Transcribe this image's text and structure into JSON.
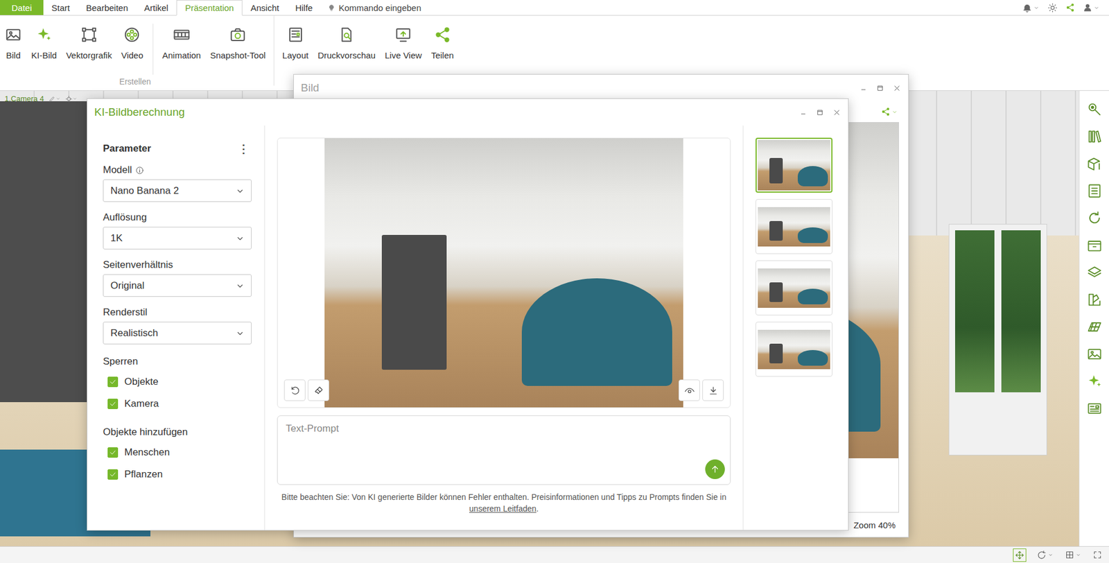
{
  "menubar": {
    "tabs": [
      {
        "label": "Datei",
        "kind": "file",
        "selected": false
      },
      {
        "label": "Start",
        "kind": "tab",
        "selected": false
      },
      {
        "label": "Bearbeiten",
        "kind": "tab",
        "selected": false
      },
      {
        "label": "Artikel",
        "kind": "tab",
        "selected": false
      },
      {
        "label": "Präsentation",
        "kind": "tab",
        "selected": true
      },
      {
        "label": "Ansicht",
        "kind": "tab",
        "selected": false
      },
      {
        "label": "Hilfe",
        "kind": "tab",
        "selected": false
      }
    ],
    "command": {
      "placeholder": "Kommando eingeben"
    }
  },
  "ribbon": {
    "groups": [
      {
        "label": "Erstellen",
        "sections": [
          [
            "Bild",
            "KI-Bild",
            "Vektorgrafik",
            "Video"
          ],
          [
            "Animation",
            "Snapshot-Tool"
          ]
        ]
      },
      {
        "sections": [
          [
            "Layout",
            "Druckvorschau",
            "Live View",
            "Teilen"
          ]
        ]
      }
    ]
  },
  "viewport": {
    "camera": "1.Camera 4"
  },
  "image_window": {
    "title": "Bild",
    "zoom": "Zoom 40%"
  },
  "ai_window": {
    "title": "KI-Bildberechnung",
    "parameters": {
      "heading": "Parameter",
      "menu": "⋮",
      "fields": [
        {
          "label": "Modell",
          "value": "Nano Banana 2",
          "kind": "info"
        },
        {
          "label": "Auflösung",
          "value": "1K",
          "kind": "plain"
        },
        {
          "label": "Seitenverhältnis",
          "value": "Original",
          "kind": "plain"
        },
        {
          "label": "Renderstil",
          "value": "Realistisch",
          "kind": "plain"
        }
      ],
      "checkbox_groups": [
        {
          "label": "Sperren",
          "items": [
            {
              "label": "Objekte",
              "checked": true
            },
            {
              "label": "Kamera",
              "checked": true
            }
          ]
        },
        {
          "label": "Objekte hinzufügen",
          "items": [
            {
              "label": "Menschen",
              "checked": true
            },
            {
              "label": "Pflanzen",
              "checked": true
            }
          ]
        }
      ]
    },
    "thumbnails": [
      {
        "selected": true
      },
      {
        "selected": false
      },
      {
        "selected": false
      },
      {
        "selected": false
      }
    ],
    "prompt": {
      "placeholder": "Text-Prompt"
    },
    "disclaimer": {
      "text": "Bitte beachten Sie: Von KI generierte Bilder können Fehler enthalten. Preisinformationen und Tipps zu Prompts finden Sie in ",
      "link": "unserem Leitfaden",
      "end": "."
    }
  }
}
